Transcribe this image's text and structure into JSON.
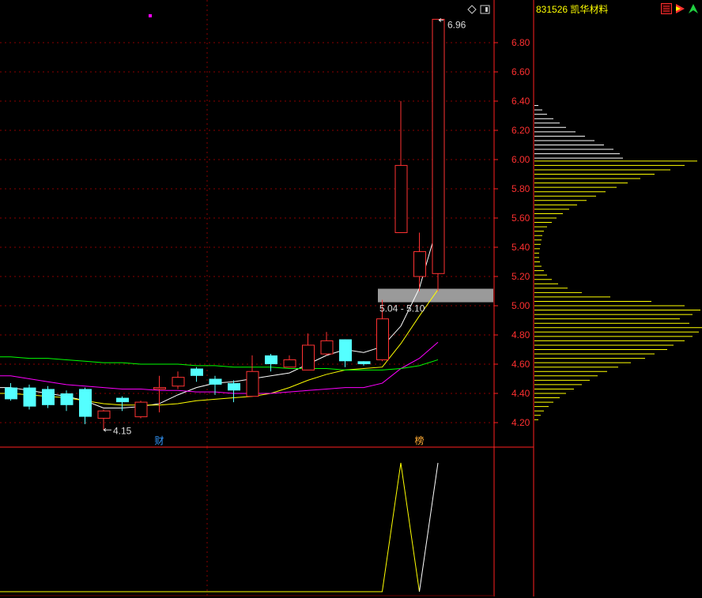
{
  "window": {
    "stock_code": "831526",
    "stock_name": "凯华材料",
    "icons": [
      "diamond-icon",
      "window-toggle-icon",
      "chart-list-icon",
      "play-flag-icon",
      "green-arrow-icon"
    ]
  },
  "colors": {
    "background": "#000000",
    "grid": "#8a0000",
    "axis_line": "#ff2020",
    "axis_text": "#ff3030",
    "up_candle": "#ff3232",
    "down_candle": "#54ffff",
    "ma5": "#ffffff",
    "ma10": "#ffff00",
    "ma20": "#ff00ff",
    "ma60": "#00ff00",
    "volume_profile_upper": "#ffffff",
    "volume_profile_lower": "#ffff00",
    "indicator_line": "#ffff00",
    "indicator_line_last": "#ffffff",
    "label_text": "#dddddd",
    "marker_text": "#3399ff",
    "marker_text_2": "#ffaa33"
  },
  "chart_data": {
    "type": "candlestick",
    "y_ticks": [
      "4.20",
      "4.40",
      "4.60",
      "4.80",
      "5.00",
      "5.20",
      "5.40",
      "5.60",
      "5.80",
      "6.00",
      "6.20",
      "6.40",
      "6.60",
      "6.80"
    ],
    "ylim": [
      4.08,
      6.98
    ],
    "candles": [
      {
        "o": 4.44,
        "h": 4.47,
        "l": 4.35,
        "c": 4.36
      },
      {
        "o": 4.44,
        "h": 4.46,
        "l": 4.29,
        "c": 4.31
      },
      {
        "o": 4.43,
        "h": 4.45,
        "l": 4.3,
        "c": 4.32
      },
      {
        "o": 4.4,
        "h": 4.42,
        "l": 4.28,
        "c": 4.32
      },
      {
        "o": 4.43,
        "h": 4.44,
        "l": 4.19,
        "c": 4.24
      },
      {
        "o": 4.23,
        "h": 4.29,
        "l": 4.15,
        "c": 4.28
      },
      {
        "o": 4.37,
        "h": 4.38,
        "l": 4.28,
        "c": 4.34
      },
      {
        "o": 4.24,
        "h": 4.35,
        "l": 4.23,
        "c": 4.34
      },
      {
        "o": 4.43,
        "h": 4.52,
        "l": 4.27,
        "c": 4.44
      },
      {
        "o": 4.45,
        "h": 4.55,
        "l": 4.43,
        "c": 4.51
      },
      {
        "o": 4.57,
        "h": 4.58,
        "l": 4.48,
        "c": 4.52
      },
      {
        "o": 4.5,
        "h": 4.52,
        "l": 4.39,
        "c": 4.46
      },
      {
        "o": 4.47,
        "h": 4.49,
        "l": 4.34,
        "c": 4.42
      },
      {
        "o": 4.38,
        "h": 4.66,
        "l": 4.38,
        "c": 4.55
      },
      {
        "o": 4.66,
        "h": 4.67,
        "l": 4.55,
        "c": 4.6
      },
      {
        "o": 4.58,
        "h": 4.66,
        "l": 4.58,
        "c": 4.63
      },
      {
        "o": 4.56,
        "h": 4.81,
        "l": 4.56,
        "c": 4.73
      },
      {
        "o": 4.67,
        "h": 4.82,
        "l": 4.66,
        "c": 4.76
      },
      {
        "o": 4.77,
        "h": 4.77,
        "l": 4.58,
        "c": 4.62
      },
      {
        "o": 4.62,
        "h": 4.62,
        "l": 4.59,
        "c": 4.6
      },
      {
        "o": 4.63,
        "h": 5.04,
        "l": 4.62,
        "c": 4.91
      },
      {
        "o": 5.5,
        "h": 6.4,
        "l": 5.5,
        "c": 5.96
      },
      {
        "o": 5.2,
        "h": 5.5,
        "l": 5.1,
        "c": 5.37
      },
      {
        "o": 5.22,
        "h": 6.96,
        "l": 5.1,
        "c": 6.96
      }
    ],
    "moving_averages": [
      {
        "name": "MA5",
        "values": [
          4.44,
          4.42,
          4.4,
          4.38,
          4.35,
          4.3,
          4.3,
          4.31,
          4.33,
          4.39,
          4.44,
          4.47,
          4.48,
          4.5,
          4.52,
          4.54,
          4.6,
          4.66,
          4.7,
          4.68,
          4.72,
          4.86,
          5.12,
          5.56
        ]
      },
      {
        "name": "MA10",
        "values": [
          4.4,
          4.39,
          4.38,
          4.37,
          4.35,
          4.33,
          4.32,
          4.32,
          4.32,
          4.33,
          4.35,
          4.36,
          4.37,
          4.38,
          4.4,
          4.44,
          4.49,
          4.53,
          4.56,
          4.57,
          4.58,
          4.74,
          4.93,
          5.11
        ]
      },
      {
        "name": "MA20",
        "values": [
          4.52,
          4.5,
          4.48,
          4.46,
          4.45,
          4.44,
          4.43,
          4.43,
          4.42,
          4.42,
          4.41,
          4.41,
          4.4,
          4.4,
          4.4,
          4.41,
          4.42,
          4.43,
          4.44,
          4.44,
          4.47,
          4.57,
          4.64,
          4.75
        ]
      },
      {
        "name": "MA60",
        "values": [
          4.65,
          4.64,
          4.64,
          4.63,
          4.62,
          4.61,
          4.61,
          4.6,
          4.6,
          4.6,
          4.59,
          4.59,
          4.58,
          4.58,
          4.58,
          4.57,
          4.57,
          4.57,
          4.56,
          4.56,
          4.56,
          4.57,
          4.59,
          4.63
        ]
      }
    ],
    "high_label": "6.96",
    "low_label": "4.15",
    "range_band": {
      "low": 5.04,
      "high": 5.1,
      "label": "5.04 - 5.10"
    },
    "markers": [
      {
        "text": "财",
        "index": 8
      },
      {
        "text": "榜",
        "index": 22
      }
    ],
    "volume_profile": {
      "upper_prices": [
        6.37,
        6.34,
        6.31,
        6.28,
        6.25,
        6.22,
        6.19,
        6.16,
        6.13,
        6.1,
        6.07,
        6.04,
        6.01
      ],
      "upper_lengths": [
        5,
        10,
        16,
        24,
        32,
        40,
        52,
        64,
        76,
        88,
        100,
        108,
        112
      ],
      "lower_prices": [
        5.99,
        5.96,
        5.93,
        5.9,
        5.87,
        5.84,
        5.81,
        5.78,
        5.75,
        5.72,
        5.69,
        5.66,
        5.63,
        5.6,
        5.57,
        5.54,
        5.51,
        5.48,
        5.45,
        5.42,
        5.39,
        5.36,
        5.33,
        5.3,
        5.27,
        5.24,
        5.21,
        5.18,
        5.15,
        5.12,
        5.09,
        5.06,
        5.03,
        5.0,
        4.97,
        4.94,
        4.91,
        4.88,
        4.85,
        4.82,
        4.79,
        4.76,
        4.73,
        4.7,
        4.67,
        4.64,
        4.61,
        4.58,
        4.55,
        4.52,
        4.49,
        4.46,
        4.43,
        4.4,
        4.37,
        4.34,
        4.31,
        4.28,
        4.25,
        4.22
      ],
      "lower_lengths": [
        206,
        190,
        172,
        152,
        134,
        118,
        104,
        90,
        78,
        66,
        54,
        44,
        36,
        28,
        22,
        16,
        12,
        10,
        9,
        8,
        7,
        6,
        6,
        7,
        9,
        12,
        16,
        22,
        30,
        42,
        60,
        96,
        148,
        190,
        210,
        200,
        184,
        196,
        214,
        208,
        200,
        190,
        176,
        168,
        152,
        140,
        122,
        106,
        92,
        80,
        70,
        60,
        50,
        40,
        32,
        24,
        18,
        12,
        8,
        5
      ]
    },
    "indicator": {
      "values": [
        0,
        0,
        0,
        0,
        0,
        0,
        0,
        0,
        0,
        0,
        0,
        0,
        0,
        0,
        0,
        0,
        0,
        0,
        0,
        0,
        0,
        1,
        0,
        1
      ]
    }
  }
}
